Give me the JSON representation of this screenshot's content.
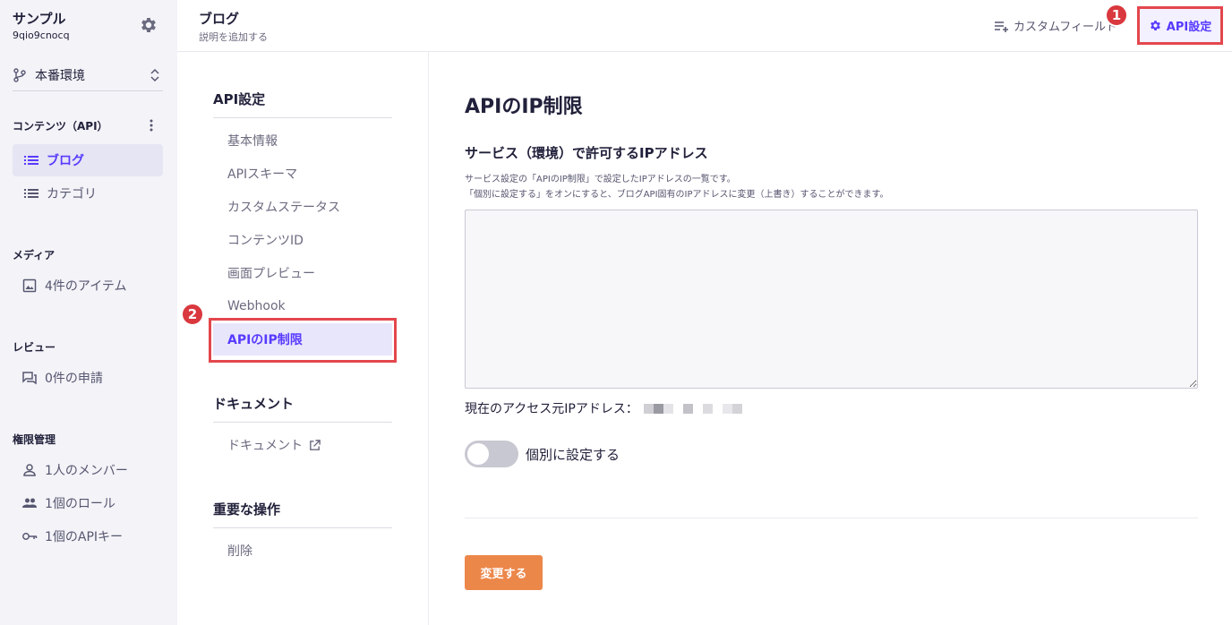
{
  "sidebar": {
    "service_name": "サンプル",
    "service_id": "9qio9cnocq",
    "environment": "本番環境",
    "sections": {
      "contents": "コンテンツ（API）",
      "media": "メディア",
      "review": "レビュー",
      "permissions": "権限管理"
    },
    "contents_items": [
      "ブログ",
      "カテゴリ"
    ],
    "media_item": "4件のアイテム",
    "review_item": "0件の申請",
    "permission_items": [
      "1人のメンバー",
      "1個のロール",
      "1個のAPIキー"
    ]
  },
  "header": {
    "title": "ブログ",
    "description": "説明を追加する",
    "custom_fields_label": "カスタムフィールド",
    "api_settings_label": "API設定"
  },
  "badges": [
    "1",
    "2"
  ],
  "settings_menu": {
    "api_heading": "API設定",
    "api_items": [
      "基本情報",
      "APIスキーマ",
      "カスタムステータス",
      "コンテンツID",
      "画面プレビュー",
      "Webhook",
      "APIのIP制限"
    ],
    "docs_heading": "ドキュメント",
    "docs_item": "ドキュメント",
    "danger_heading": "重要な操作",
    "danger_item": "削除"
  },
  "main": {
    "title": "APIのIP制限",
    "field_label": "サービス（環境）で許可するIPアドレス",
    "description_line1": "サービス設定の「APIのIP制限」で設定したIPアドレスの一覧です。",
    "description_line2": "「個別に設定する」をオンにすると、ブログAPI固有のIPアドレスに変更（上書き）することができます。",
    "ip_textarea_value": "",
    "current_ip_label": "現在のアクセス元IPアドレス：",
    "toggle_label": "個別に設定する",
    "toggle_on": false,
    "submit_label": "変更する"
  },
  "colors": {
    "accent": "#563bff",
    "highlight_border": "#e3474d",
    "submit_button": "#ec874a",
    "sidebar_bg": "#f3f3f8"
  }
}
